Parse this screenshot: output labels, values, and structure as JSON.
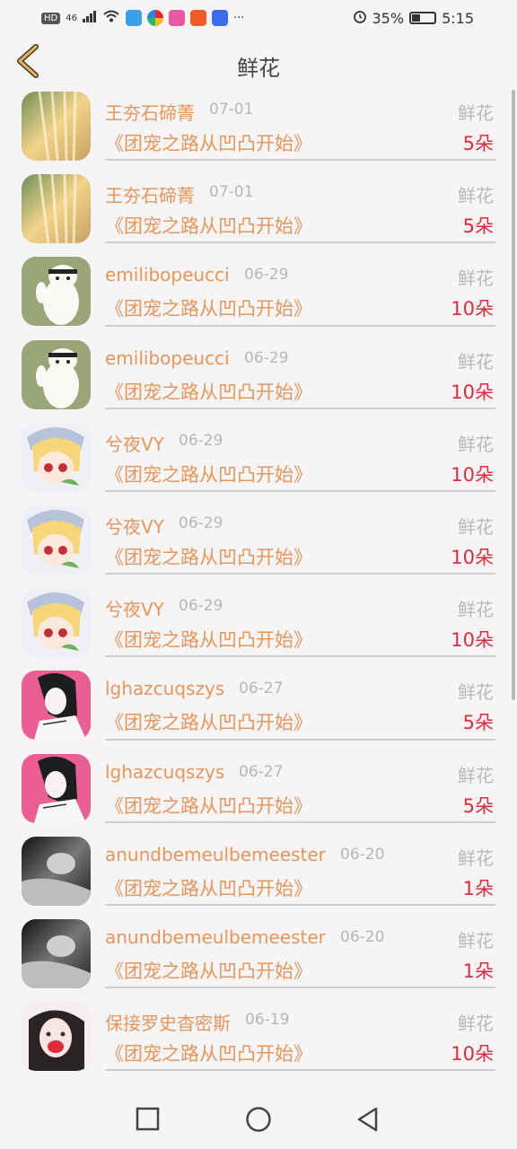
{
  "status": {
    "badge_hd": "HD",
    "signal": "46",
    "battery": "35%",
    "time": "5:15",
    "battery_level": 0.35
  },
  "header": {
    "title": "鲜花"
  },
  "list": [
    {
      "name": "王夯石碲菁",
      "date": "07-01",
      "type": "鲜花",
      "book": "《团宠之路从凹凸开始》",
      "count": "5朵",
      "avatar": "light-rays"
    },
    {
      "name": "王夯石碲菁",
      "date": "07-01",
      "type": "鲜花",
      "book": "《团宠之路从凹凸开始》",
      "count": "5朵",
      "avatar": "light-rays"
    },
    {
      "name": "emilibopeucci",
      "date": "06-29",
      "type": "鲜花",
      "book": "《团宠之路从凹凸开始》",
      "count": "10朵",
      "avatar": "polar-bear"
    },
    {
      "name": "emilibopeucci",
      "date": "06-29",
      "type": "鲜花",
      "book": "《团宠之路从凹凸开始》",
      "count": "10朵",
      "avatar": "polar-bear"
    },
    {
      "name": "兮夜VY",
      "date": "06-29",
      "type": "鲜花",
      "book": "《团宠之路从凹凸开始》",
      "count": "10朵",
      "avatar": "anime-blonde"
    },
    {
      "name": "兮夜VY",
      "date": "06-29",
      "type": "鲜花",
      "book": "《团宠之路从凹凸开始》",
      "count": "10朵",
      "avatar": "anime-blonde"
    },
    {
      "name": "兮夜VY",
      "date": "06-29",
      "type": "鲜花",
      "book": "《团宠之路从凹凸开始》",
      "count": "10朵",
      "avatar": "anime-blonde"
    },
    {
      "name": "lghazcuqszys",
      "date": "06-27",
      "type": "鲜花",
      "book": "《团宠之路从凹凸开始》",
      "count": "5朵",
      "avatar": "dark-hair-pink"
    },
    {
      "name": "lghazcuqszys",
      "date": "06-27",
      "type": "鲜花",
      "book": "《团宠之路从凹凸开始》",
      "count": "5朵",
      "avatar": "dark-hair-pink"
    },
    {
      "name": "anundbemeulbemeester",
      "date": "06-20",
      "type": "鲜花",
      "book": "《团宠之路从凹凸开始》",
      "count": "1朵",
      "avatar": "monochrome-portrait"
    },
    {
      "name": "anundbemeulbemeester",
      "date": "06-20",
      "type": "鲜花",
      "book": "《团宠之路从凹凸开始》",
      "count": "1朵",
      "avatar": "monochrome-portrait"
    },
    {
      "name": "保接罗史杳密斯",
      "date": "06-19",
      "type": "鲜花",
      "book": "《团宠之路从凹凸开始》",
      "count": "10朵",
      "avatar": "girl-red"
    }
  ],
  "colors": {
    "accent": "#e5965b",
    "count": "#e02b3c",
    "muted": "#b8b8b8",
    "back_arrow": "#e8b64a"
  },
  "nav": {
    "recent": "square-icon",
    "home": "circle-icon",
    "back": "triangle-back-icon"
  }
}
